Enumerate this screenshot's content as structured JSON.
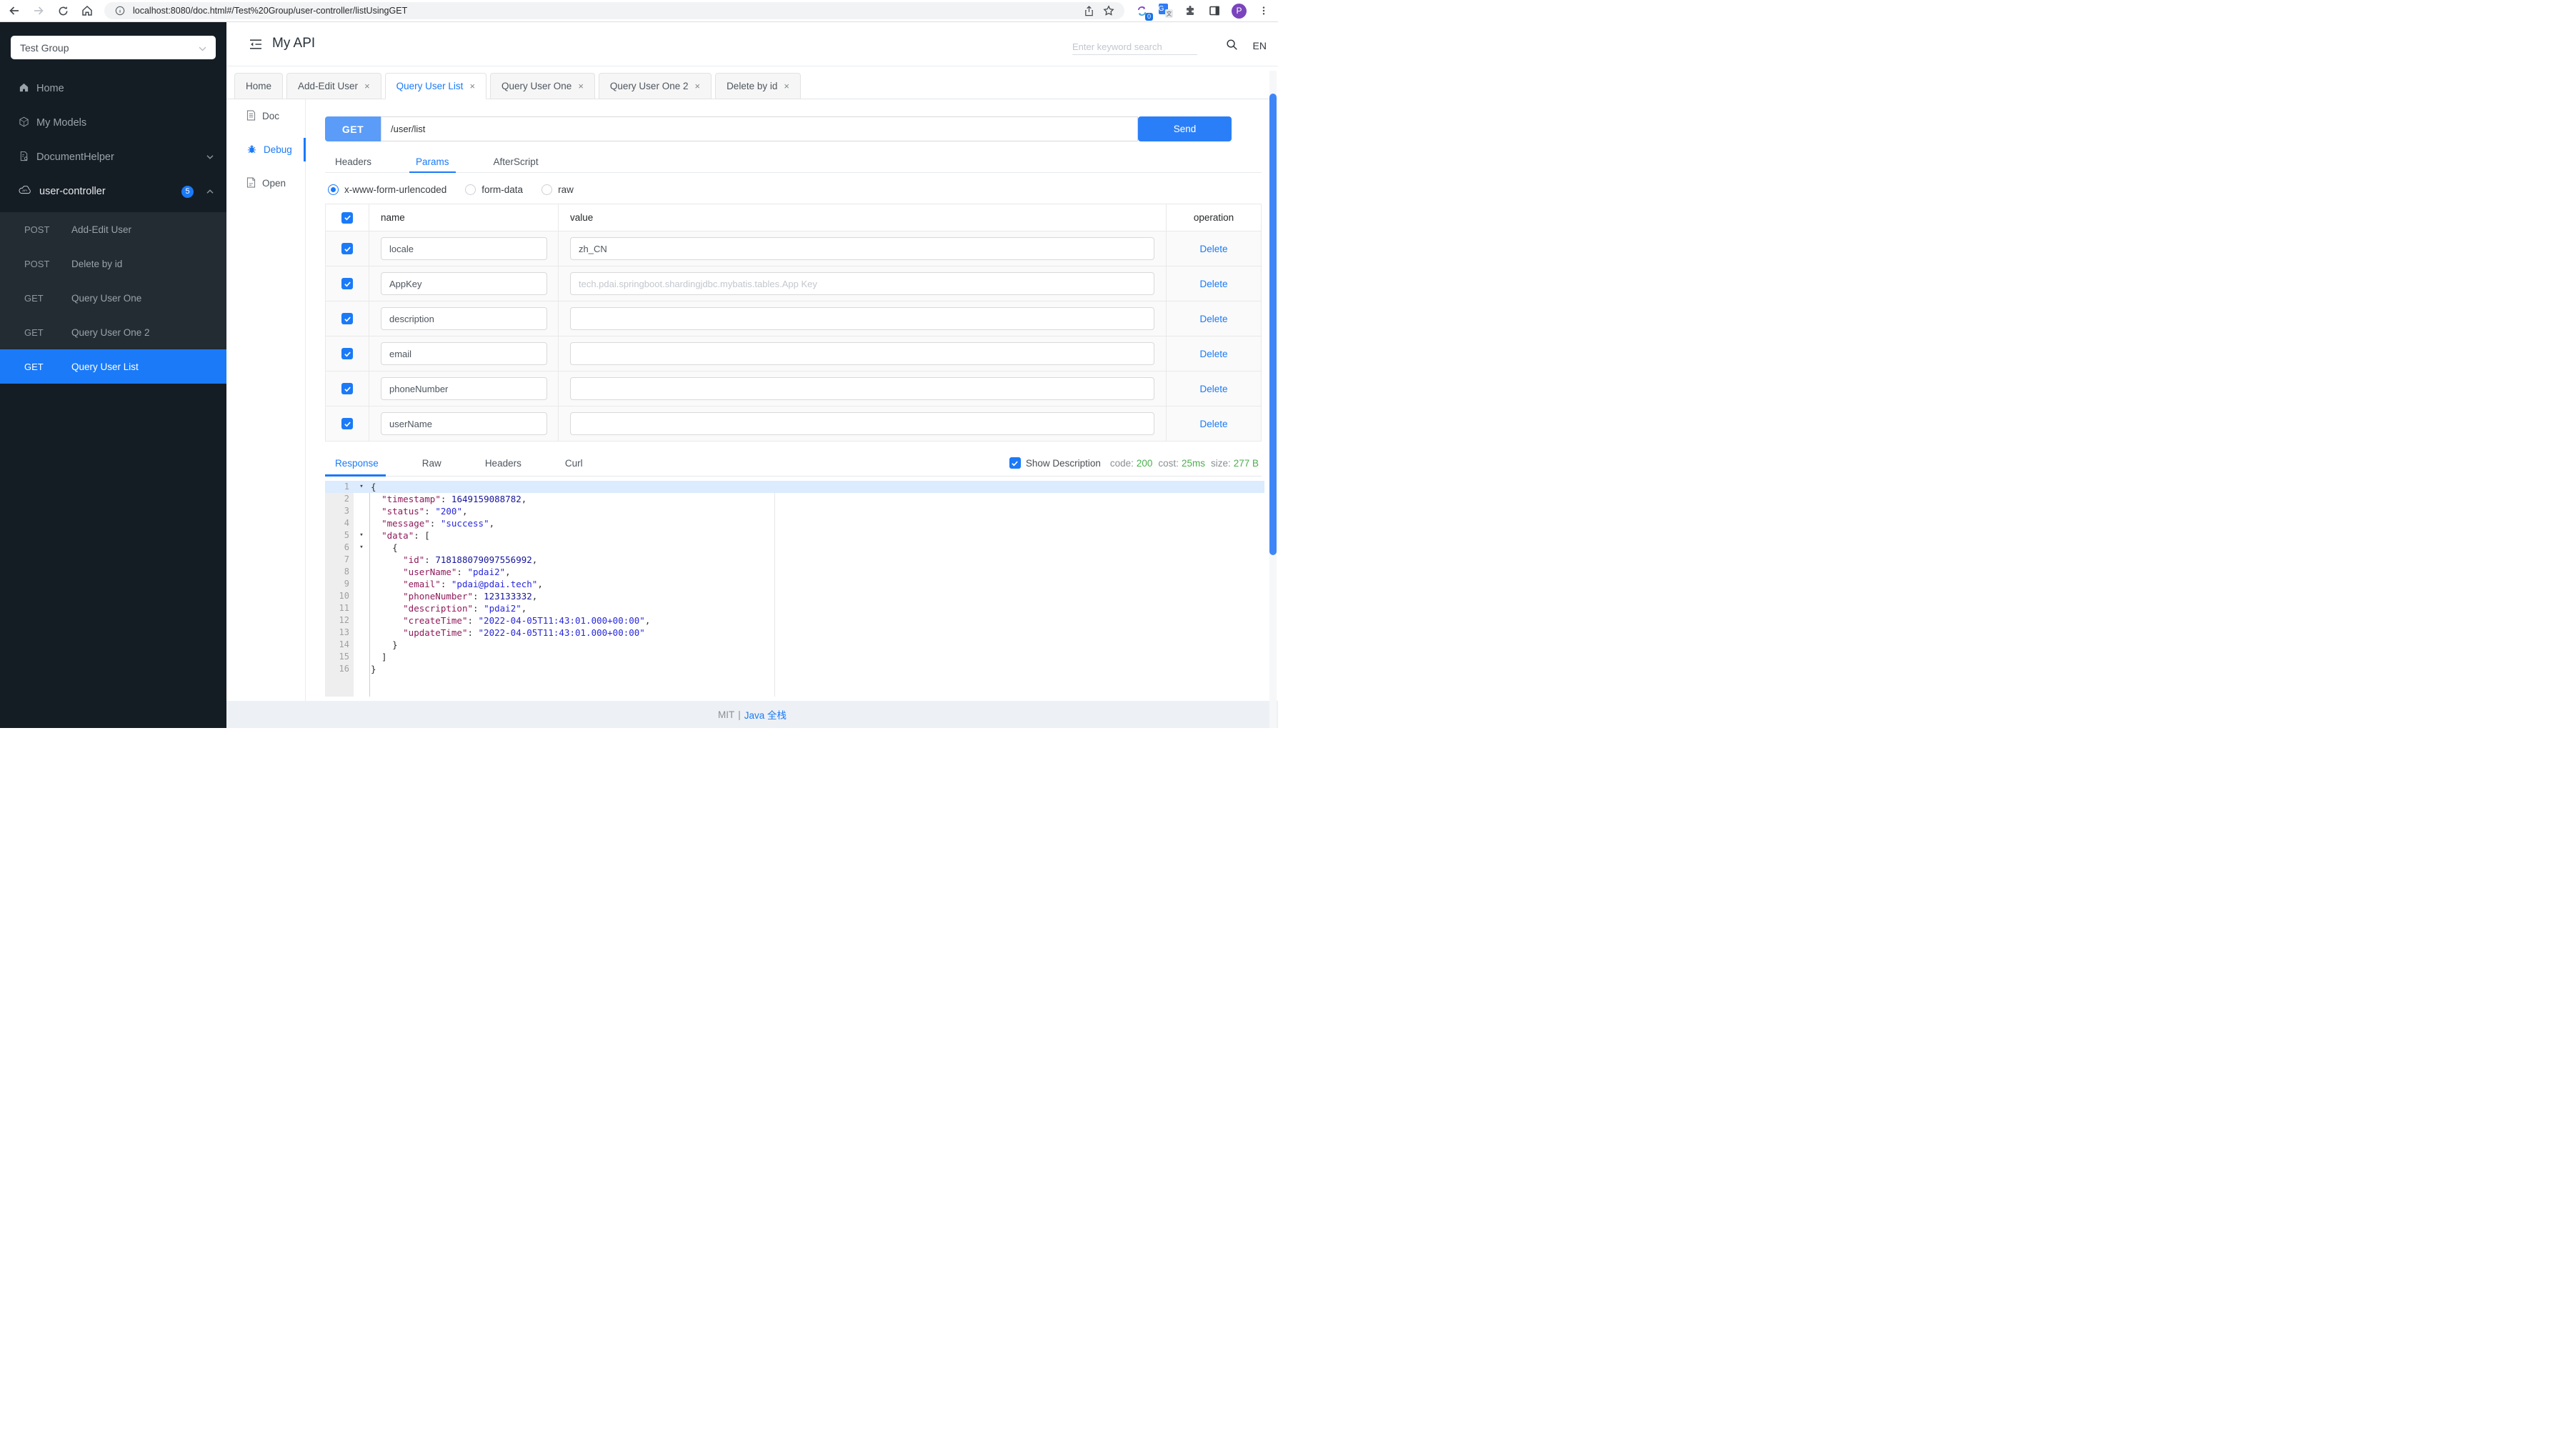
{
  "browser": {
    "url": "localhost:8080/doc.html#/Test%20Group/user-controller/listUsingGET",
    "extension_badge": "0",
    "avatar_initial": "P"
  },
  "sidebar": {
    "group_select": "Test Group",
    "items": [
      {
        "label": "Home",
        "icon": "home-icon"
      },
      {
        "label": "My Models",
        "icon": "models-icon"
      },
      {
        "label": "DocumentHelper",
        "icon": "document-helper-icon",
        "chevron": "down"
      },
      {
        "label": "user-controller",
        "icon": "api-cloud-icon",
        "badge": "5",
        "chevron": "up",
        "bright": true
      }
    ],
    "endpoints": [
      {
        "method": "POST",
        "label": "Add-Edit User",
        "selected": false
      },
      {
        "method": "POST",
        "label": "Delete by id",
        "selected": false
      },
      {
        "method": "GET",
        "label": "Query User One",
        "selected": false
      },
      {
        "method": "GET",
        "label": "Query User One 2",
        "selected": false
      },
      {
        "method": "GET",
        "label": "Query User List",
        "selected": true
      }
    ]
  },
  "header": {
    "title": "My API",
    "search_placeholder": "Enter keyword search",
    "lang": "EN"
  },
  "tabs": [
    {
      "label": "Home",
      "closable": false,
      "active": false
    },
    {
      "label": "Add-Edit User",
      "closable": true,
      "active": false
    },
    {
      "label": "Query User List",
      "closable": true,
      "active": true
    },
    {
      "label": "Query User One",
      "closable": true,
      "active": false
    },
    {
      "label": "Query User One 2",
      "closable": true,
      "active": false
    },
    {
      "label": "Delete by id",
      "closable": true,
      "active": false
    }
  ],
  "side_tools": [
    {
      "label": "Doc",
      "icon": "doc-icon",
      "active": false
    },
    {
      "label": "Debug",
      "icon": "bug-icon",
      "active": true
    },
    {
      "label": "Open",
      "icon": "open-file-icon",
      "active": false
    }
  ],
  "request": {
    "method": "GET",
    "url": "/user/list",
    "send_label": "Send"
  },
  "request_tabs": [
    {
      "label": "Headers",
      "active": false
    },
    {
      "label": "Params",
      "active": true
    },
    {
      "label": "AfterScript",
      "active": false
    }
  ],
  "body_types": [
    {
      "label": "x-www-form-urlencoded",
      "selected": true
    },
    {
      "label": "form-data",
      "selected": false
    },
    {
      "label": "raw",
      "selected": false
    }
  ],
  "params_table": {
    "columns": [
      "name",
      "value",
      "operation"
    ],
    "delete_label": "Delete",
    "rows": [
      {
        "checked": true,
        "name": "locale",
        "value": "zh_CN",
        "value_placeholder": ""
      },
      {
        "checked": true,
        "name": "AppKey",
        "value": "",
        "value_placeholder": "tech.pdai.springboot.shardingjdbc.mybatis.tables.App Key"
      },
      {
        "checked": true,
        "name": "description",
        "value": "",
        "value_placeholder": ""
      },
      {
        "checked": true,
        "name": "email",
        "value": "",
        "value_placeholder": ""
      },
      {
        "checked": true,
        "name": "phoneNumber",
        "value": "",
        "value_placeholder": ""
      },
      {
        "checked": true,
        "name": "userName",
        "value": "",
        "value_placeholder": ""
      }
    ]
  },
  "response": {
    "tabs": [
      {
        "label": "Response",
        "active": true
      },
      {
        "label": "Raw",
        "active": false
      },
      {
        "label": "Headers",
        "active": false
      },
      {
        "label": "Curl",
        "active": false
      }
    ],
    "show_description_label": "Show Description",
    "show_description_checked": true,
    "meta": [
      {
        "label": "code:",
        "value": "200"
      },
      {
        "label": "cost:",
        "value": "25ms"
      },
      {
        "label": "size:",
        "value": "277 B"
      }
    ],
    "code_lines": [
      {
        "n": 1,
        "fold": true,
        "hl": true,
        "tokens": [
          [
            "p",
            "{"
          ]
        ]
      },
      {
        "n": 2,
        "tokens": [
          [
            "p",
            "  "
          ],
          [
            "k",
            "\"timestamp\""
          ],
          [
            "p",
            ": "
          ],
          [
            "num",
            "1649159088782"
          ],
          [
            "p",
            ","
          ]
        ]
      },
      {
        "n": 3,
        "tokens": [
          [
            "p",
            "  "
          ],
          [
            "k",
            "\"status\""
          ],
          [
            "p",
            ": "
          ],
          [
            "s",
            "\"200\""
          ],
          [
            "p",
            ","
          ]
        ]
      },
      {
        "n": 4,
        "tokens": [
          [
            "p",
            "  "
          ],
          [
            "k",
            "\"message\""
          ],
          [
            "p",
            ": "
          ],
          [
            "s",
            "\"success\""
          ],
          [
            "p",
            ","
          ]
        ]
      },
      {
        "n": 5,
        "fold": true,
        "tokens": [
          [
            "p",
            "  "
          ],
          [
            "k",
            "\"data\""
          ],
          [
            "p",
            ": ["
          ]
        ]
      },
      {
        "n": 6,
        "fold": true,
        "tokens": [
          [
            "p",
            "    {"
          ]
        ]
      },
      {
        "n": 7,
        "tokens": [
          [
            "p",
            "      "
          ],
          [
            "k",
            "\"id\""
          ],
          [
            "p",
            ": "
          ],
          [
            "num",
            "718188079097556992"
          ],
          [
            "p",
            ","
          ]
        ]
      },
      {
        "n": 8,
        "tokens": [
          [
            "p",
            "      "
          ],
          [
            "k",
            "\"userName\""
          ],
          [
            "p",
            ": "
          ],
          [
            "s",
            "\"pdai2\""
          ],
          [
            "p",
            ","
          ]
        ]
      },
      {
        "n": 9,
        "tokens": [
          [
            "p",
            "      "
          ],
          [
            "k",
            "\"email\""
          ],
          [
            "p",
            ": "
          ],
          [
            "s",
            "\"pdai@pdai.tech\""
          ],
          [
            "p",
            ","
          ]
        ]
      },
      {
        "n": 10,
        "tokens": [
          [
            "p",
            "      "
          ],
          [
            "k",
            "\"phoneNumber\""
          ],
          [
            "p",
            ": "
          ],
          [
            "num",
            "123133332"
          ],
          [
            "p",
            ","
          ]
        ]
      },
      {
        "n": 11,
        "tokens": [
          [
            "p",
            "      "
          ],
          [
            "k",
            "\"description\""
          ],
          [
            "p",
            ": "
          ],
          [
            "s",
            "\"pdai2\""
          ],
          [
            "p",
            ","
          ]
        ]
      },
      {
        "n": 12,
        "tokens": [
          [
            "p",
            "      "
          ],
          [
            "k",
            "\"createTime\""
          ],
          [
            "p",
            ": "
          ],
          [
            "s",
            "\"2022-04-05T11:43:01.000+00:00\""
          ],
          [
            "p",
            ","
          ]
        ]
      },
      {
        "n": 13,
        "tokens": [
          [
            "p",
            "      "
          ],
          [
            "k",
            "\"updateTime\""
          ],
          [
            "p",
            ": "
          ],
          [
            "s",
            "\"2022-04-05T11:43:01.000+00:00\""
          ]
        ]
      },
      {
        "n": 14,
        "tokens": [
          [
            "p",
            "    }"
          ]
        ]
      },
      {
        "n": 15,
        "tokens": [
          [
            "p",
            "  ]"
          ]
        ]
      },
      {
        "n": 16,
        "tokens": [
          [
            "p",
            "}"
          ]
        ]
      }
    ]
  },
  "footer": {
    "license": "MIT",
    "separator": "|",
    "link": "Java 全栈"
  },
  "colors": {
    "accent": "#1a7af8",
    "get_button": "#5b9cf8",
    "send_button": "#2a7ff8",
    "success": "#4cae4f",
    "sidebar_bg": "#151d24",
    "selected_row": "#1a7af8",
    "scrollbar": "#3e86f8",
    "code_key": "#8e1a5a",
    "code_string": "#2727dd",
    "code_number": "#15159a",
    "code_punct": "#2f2f2f",
    "code_highlight": "#dcebfd"
  }
}
